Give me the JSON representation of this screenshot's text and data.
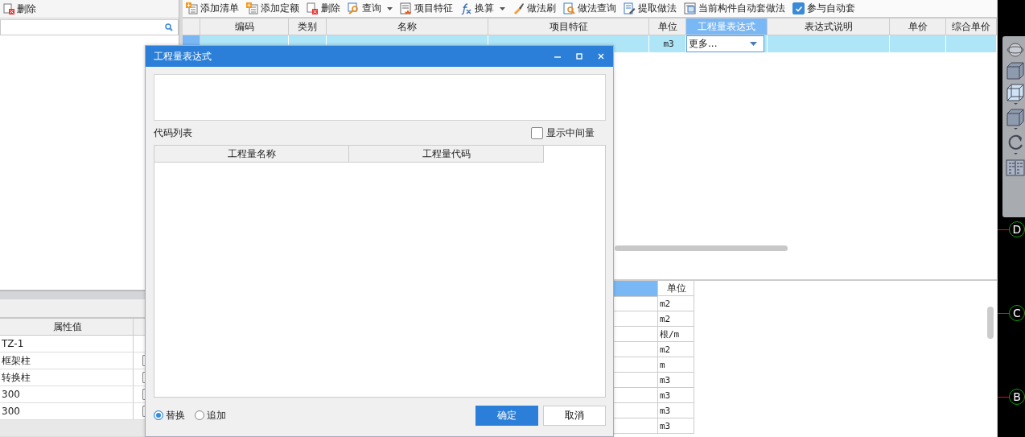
{
  "left_panel": {
    "toolbar": [
      {
        "label": "删除"
      }
    ],
    "properties": {
      "columns": [
        {
          "label": "属性值"
        }
      ],
      "rows": [
        {
          "value": "TZ-1",
          "kind": "plain"
        },
        {
          "value": "框架柱",
          "kind": "checkbox",
          "checked": false
        },
        {
          "value": "转换柱",
          "kind": "checkbox",
          "checked": false
        },
        {
          "value": "300",
          "kind": "checkbox",
          "checked": false
        },
        {
          "value": "300",
          "kind": "checkbox",
          "checked": false
        }
      ]
    }
  },
  "toolbar": [
    {
      "label": "添加清单",
      "kind": "button"
    },
    {
      "label": "添加定额",
      "kind": "button"
    },
    {
      "label": "删除",
      "kind": "button"
    },
    {
      "label": "查询",
      "kind": "dropdown"
    },
    {
      "label": "项目特征",
      "kind": "button"
    },
    {
      "label": "换算",
      "kind": "dropdown"
    },
    {
      "label": "做法刷",
      "kind": "button"
    },
    {
      "label": "做法查询",
      "kind": "button"
    },
    {
      "label": "提取做法",
      "kind": "button"
    },
    {
      "label": "当前构件自动套做法",
      "kind": "button"
    },
    {
      "label": "参与自动套",
      "kind": "checkbox",
      "checked": true
    }
  ],
  "table": {
    "columns": [
      {
        "label": "编码",
        "selected": false
      },
      {
        "label": "类别",
        "selected": false
      },
      {
        "label": "名称",
        "selected": false
      },
      {
        "label": "项目特征",
        "selected": false
      },
      {
        "label": "单位",
        "selected": false
      },
      {
        "label": "工程量表达式",
        "selected": true
      },
      {
        "label": "表达式说明",
        "selected": false
      },
      {
        "label": "单价",
        "selected": false
      },
      {
        "label": "综合单价",
        "selected": false
      }
    ],
    "rows": [
      {
        "unit": "m3",
        "expression": "更多...",
        "selected": true
      }
    ]
  },
  "lower_table": {
    "columns": [
      {
        "selected": true
      },
      {
        "label": "单位",
        "selected": false
      }
    ],
    "rows": [
      "m2",
      "m2",
      "根/m",
      "m2",
      "m",
      "m3",
      "m3",
      "m3",
      "m3"
    ]
  },
  "cad_view": {
    "axis_labels": [
      "D",
      "C",
      "B"
    ]
  },
  "dialog": {
    "title": "工程量表达式",
    "code_list_label": "代码列表",
    "show_intermediate": {
      "label": "显示中间量",
      "checked": false
    },
    "columns": [
      "工程量名称",
      "工程量代码"
    ],
    "modes": [
      {
        "label": "替换",
        "selected": true
      },
      {
        "label": "追加",
        "selected": false
      }
    ],
    "buttons": [
      {
        "label": "确定",
        "primary": true
      },
      {
        "label": "取消",
        "primary": false
      }
    ]
  }
}
